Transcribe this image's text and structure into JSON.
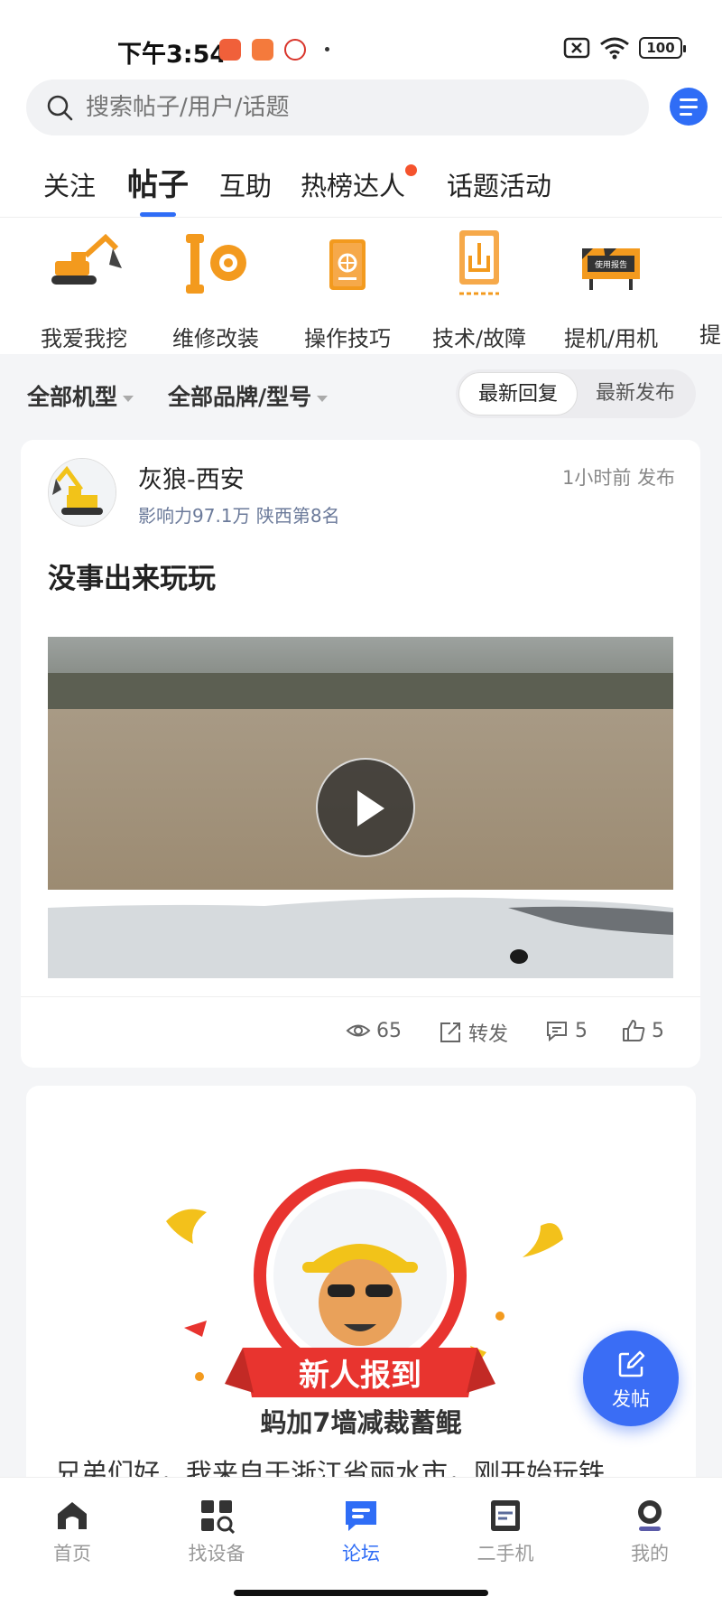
{
  "status_bar": {
    "time": "下午3:54",
    "battery": "100"
  },
  "search": {
    "placeholder": "搜索帖子/用户/话题"
  },
  "tabs": [
    {
      "label": "关注"
    },
    {
      "label": "帖子"
    },
    {
      "label": "互助"
    },
    {
      "label": "热榜达人"
    },
    {
      "label": "话题活动"
    }
  ],
  "active_tab": "帖子",
  "categories": [
    {
      "label": "我爱我挖",
      "icon": "excavator-icon"
    },
    {
      "label": "维修改装",
      "icon": "wrench-gear-icon"
    },
    {
      "label": "操作技巧",
      "icon": "manual-book-icon"
    },
    {
      "label": "技术/故障",
      "icon": "hydraulic-tank-icon"
    },
    {
      "label": "提机/用机",
      "icon": "usage-report-sign-icon"
    },
    {
      "label": "提"
    }
  ],
  "filters": {
    "machine_type": "全部机型",
    "brand_model": "全部品牌/型号",
    "sort_options": [
      "最新回复",
      "最新发布"
    ],
    "sort_selected": "最新回复"
  },
  "post": {
    "author": "灰狼-西安",
    "influence": "影响力97.1万  陕西第8名",
    "time": "1小时前 发布",
    "title": "没事出来玩玩",
    "views": "65",
    "share_label": "转发",
    "comments": "5",
    "likes": "5"
  },
  "newcomer_post": {
    "badge_text": "新人报到",
    "title": "蚂加7墙减裁蓄鲲",
    "text": "兄弟们好，我来自于浙江省丽水市，刚开始玩铁"
  },
  "fab": {
    "label": "发帖"
  },
  "bottom_nav": [
    {
      "label": "首页",
      "icon": "home-icon"
    },
    {
      "label": "找设备",
      "icon": "find-equipment-icon"
    },
    {
      "label": "论坛",
      "icon": "forum-icon"
    },
    {
      "label": "二手机",
      "icon": "used-machine-icon"
    },
    {
      "label": "我的",
      "icon": "profile-icon"
    }
  ],
  "colors": {
    "accent": "#2f6df6",
    "badge_red": "#e8342f",
    "notification_dot": "#f5532d"
  }
}
